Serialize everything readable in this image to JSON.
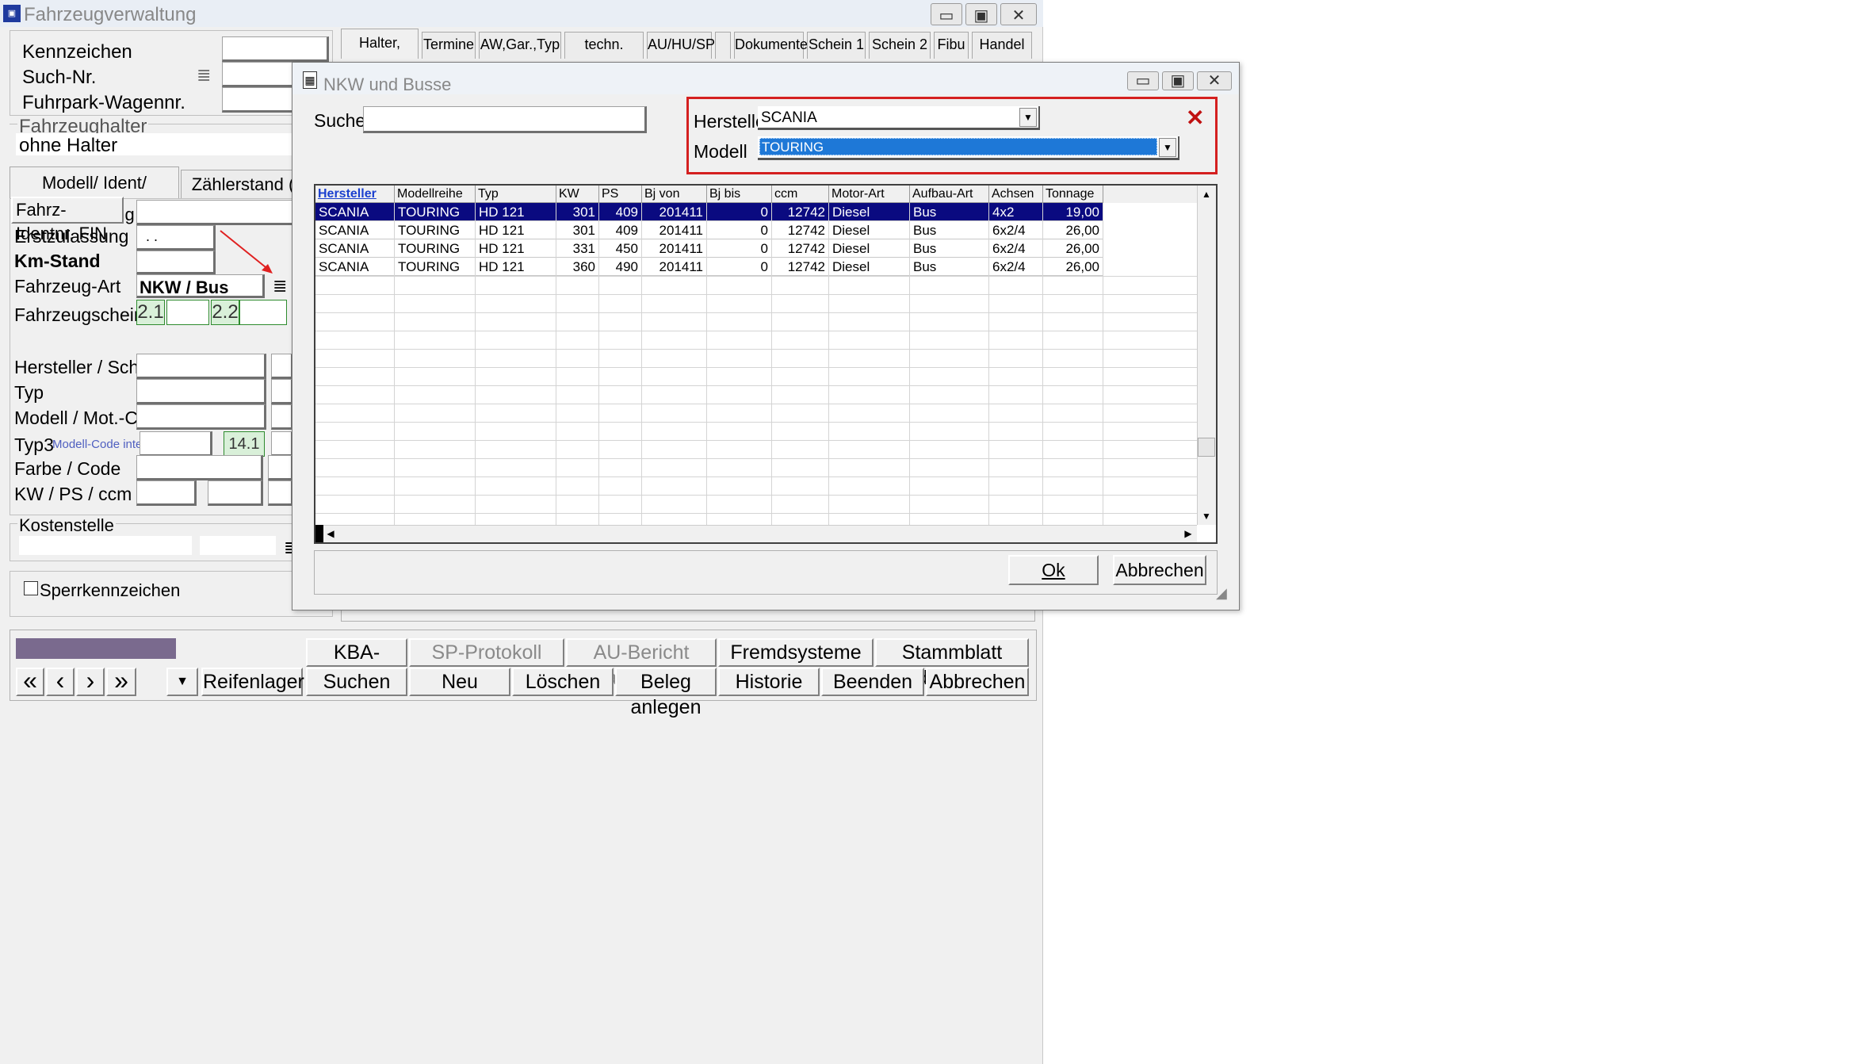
{
  "main": {
    "title": "Fahrzeugverwaltung",
    "tabs": [
      "Halter, Notiz",
      "Termine",
      "AW,Gar.,Typ",
      "techn. Daten",
      "AU/HU/SP",
      "",
      "Dokumente",
      "Schein 1",
      "Schein 2",
      "Fibu",
      "Handel"
    ],
    "kennzeichen_label": "Kennzeichen",
    "suchnr_label": "Such-Nr.",
    "fuhrpark_label": "Fuhrpark-Wagennr.",
    "fahrzeughalter_group": "Fahrzeughalter",
    "halter_value": "ohne Halter",
    "subtabs": [
      "Modell/ Ident/ Zulassung",
      "Zählerstand (KM"
    ],
    "fin_button": "Fahrz-Identnr. FIN",
    "erstzulassung_label": "Erstzulassung",
    "erstzulassung_value": ". .",
    "kmstand_label": "Km-Stand",
    "fahrzeugart_label": "Fahrzeug-Art",
    "fahrzeugart_value": "NKW / Bus",
    "fahrzeugschein_label": "Fahrzeugschein",
    "schein_21": "2.1",
    "schein_22": "2.2",
    "hersteller_label": "Hersteller / Schl.",
    "typ_label": "Typ",
    "modell_label": "Modell / Mot.-Code",
    "typ3_label": "Typ3",
    "modellcode_intern": "Modell-Code intern",
    "box_141": "14.1",
    "farbe_label": "Farbe / Code",
    "kwps_label": "KW / PS / ccm",
    "kostenstelle_group": "Kostenstelle",
    "sperr_label": "Sperrkennzeichen",
    "toolbar_row1": [
      "KBA-Daten",
      "SP-Protokoll anlegen",
      "AU-Bericht anlegen",
      "Fremdsysteme",
      "Stammblatt drucken"
    ],
    "toolbar_row2": [
      "Reifenlager",
      "Suchen",
      "Neu",
      "Löschen",
      "Beleg anlegen",
      "Historie",
      "Beenden",
      "Abbrechen"
    ],
    "nav": [
      "«",
      "‹",
      "›",
      "»"
    ],
    "dropdown_arrow": "▼"
  },
  "dialog": {
    "title": "NKW und Busse",
    "suche_label": "Suche",
    "suche_value": "",
    "hersteller_label": "Hersteller",
    "hersteller_value": "SCANIA",
    "modell_label": "Modell",
    "modell_value": "TOURING",
    "close_filter": "✕",
    "columns": [
      "Hersteller",
      "Modellreihe",
      "Typ",
      "KW",
      "PS",
      "Bj von",
      "Bj bis",
      "ccm",
      "Motor-Art",
      "Aufbau-Art",
      "Achsen",
      "Tonnage"
    ],
    "rows": [
      [
        "SCANIA",
        "TOURING",
        "HD 121",
        "301",
        "409",
        "201411",
        "0",
        "12742",
        "Diesel",
        "Bus",
        "4x2",
        "19,00"
      ],
      [
        "SCANIA",
        "TOURING",
        "HD 121",
        "301",
        "409",
        "201411",
        "0",
        "12742",
        "Diesel",
        "Bus",
        "6x2/4",
        "26,00"
      ],
      [
        "SCANIA",
        "TOURING",
        "HD 121",
        "331",
        "450",
        "201411",
        "0",
        "12742",
        "Diesel",
        "Bus",
        "6x2/4",
        "26,00"
      ],
      [
        "SCANIA",
        "TOURING",
        "HD 121",
        "360",
        "490",
        "201411",
        "0",
        "12742",
        "Diesel",
        "Bus",
        "6x2/4",
        "26,00"
      ]
    ],
    "ok_button": "Ok",
    "cancel_button": "Abbrechen"
  },
  "colors": {
    "selection": "#0a0a80",
    "highlight_border": "#d42020",
    "annotation_arrow": "#e02020",
    "combo_selected": "#1e78d7",
    "progress_bar": "#7a6a8e"
  }
}
